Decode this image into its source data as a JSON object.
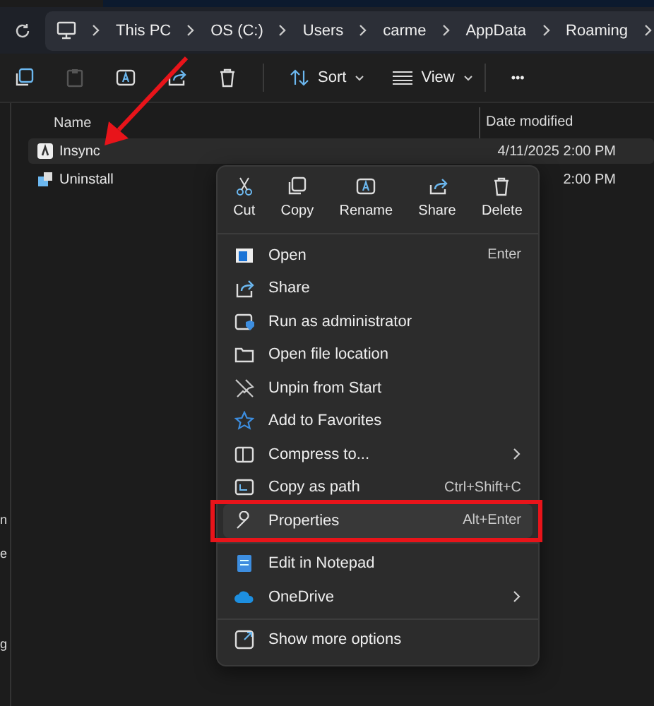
{
  "breadcrumb": [
    "This PC",
    "OS (C:)",
    "Users",
    "carme",
    "AppData",
    "Roaming"
  ],
  "toolbar": {
    "sort": "Sort",
    "view": "View",
    "more": "•••"
  },
  "columns": [
    "Name",
    "Date modified"
  ],
  "files": [
    {
      "name": "Insync",
      "date": "4/11/2025 2:00 PM",
      "selected": true
    },
    {
      "name": "Uninstall",
      "date": "2:00 PM",
      "selected": false
    }
  ],
  "sidebar_fragments": [
    "n",
    "e",
    "g"
  ],
  "context_menu": {
    "actions": [
      "Cut",
      "Copy",
      "Rename",
      "Share",
      "Delete"
    ],
    "items": [
      {
        "label": "Open",
        "shortcut": "Enter",
        "submenu": false,
        "selected": false
      },
      {
        "label": "Share",
        "submenu": false,
        "selected": false
      },
      {
        "label": "Run as administrator",
        "submenu": false,
        "selected": false
      },
      {
        "label": "Open file location",
        "submenu": false,
        "selected": false
      },
      {
        "label": "Unpin from Start",
        "submenu": false,
        "selected": false
      },
      {
        "label": "Add to Favorites",
        "submenu": false,
        "selected": false
      },
      {
        "label": "Compress to...",
        "submenu": true,
        "selected": false
      },
      {
        "label": "Copy as path",
        "shortcut": "Ctrl+Shift+C",
        "submenu": false,
        "selected": false
      },
      {
        "label": "Properties",
        "shortcut": "Alt+Enter",
        "submenu": false,
        "selected": true
      },
      {
        "label": "Edit in Notepad",
        "submenu": false,
        "selected": false,
        "divider_before": true
      },
      {
        "label": "OneDrive",
        "submenu": true,
        "selected": false
      },
      {
        "label": "Show more options",
        "submenu": false,
        "selected": false,
        "divider_before": true
      }
    ]
  }
}
